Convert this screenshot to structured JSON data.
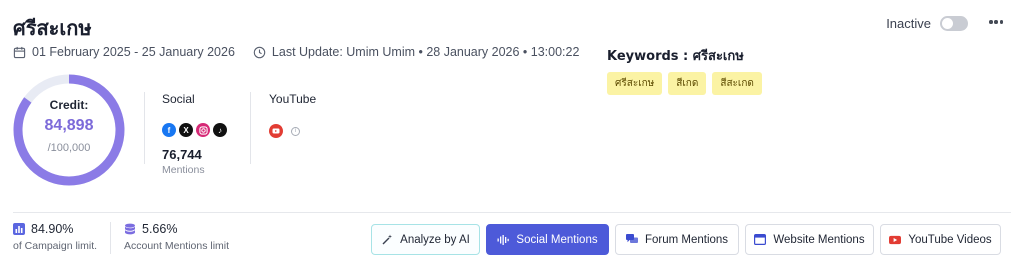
{
  "header": {
    "title": "ศรีสะเกษ",
    "date_range": "01 February 2025 - 25 January 2026",
    "last_update": "Last Update: Umim Umim • 28 January 2026 • 13:00:22",
    "status_label": "Inactive",
    "status_on": false
  },
  "keywords": {
    "heading": "Keywords : ศรีสะเกษ",
    "tags": [
      "ศรีสะเกษ",
      "สีเกด",
      "สีสะเกด"
    ]
  },
  "credit": {
    "label": "Credit:",
    "value": "84,898",
    "max": "/100,000",
    "fraction_used": 0.84898,
    "ring_color": "#8b7be6",
    "track_color": "#e8ebf4"
  },
  "social": {
    "heading": "Social",
    "icons": [
      "facebook-icon",
      "x-icon",
      "instagram-icon",
      "tiktok-icon"
    ],
    "count": "76,744",
    "unit": "Mentions"
  },
  "youtube": {
    "heading": "YouTube"
  },
  "stats": {
    "campaign": {
      "value": "84.90%",
      "desc": "of Campaign limit."
    },
    "account": {
      "value": "5.66%",
      "desc": "Account Mentions limit"
    }
  },
  "actions": {
    "analyze": "Analyze by AI",
    "social": "Social Mentions",
    "forum": "Forum Mentions",
    "website": "Website Mentions",
    "youtube": "YouTube Videos"
  },
  "colors": {
    "accent": "#4d5ad9",
    "keyword_bg": "#fbf3a4",
    "youtube_red": "#e23c33"
  }
}
